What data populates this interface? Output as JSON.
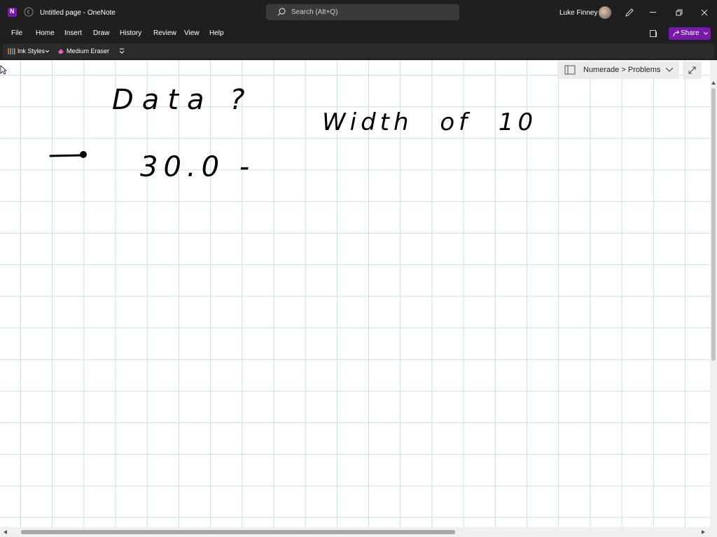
{
  "titlebar": {
    "page_title": "Untitled page",
    "separator": "-",
    "app_name": "OneNote",
    "search_placeholder": "Search (Alt+Q)",
    "user_name": "Luke Finney"
  },
  "menu": {
    "items": [
      "File",
      "Home",
      "Insert",
      "Draw",
      "History",
      "Review",
      "View",
      "Help"
    ],
    "share_label": "Share"
  },
  "ribbon": {
    "ink_styles_label": "Ink Styles",
    "eraser_label": "Medium Eraser"
  },
  "notebook": {
    "breadcrumb": "Numerade > Problems"
  },
  "ink": {
    "line1": "Data ?",
    "line2": "Width of 10",
    "line3": "30.0 -"
  },
  "colors": {
    "chrome_bg": "#1f1f1f",
    "accent": "#7719aa",
    "grid": "#bfe3ef",
    "ink": "#000000"
  }
}
